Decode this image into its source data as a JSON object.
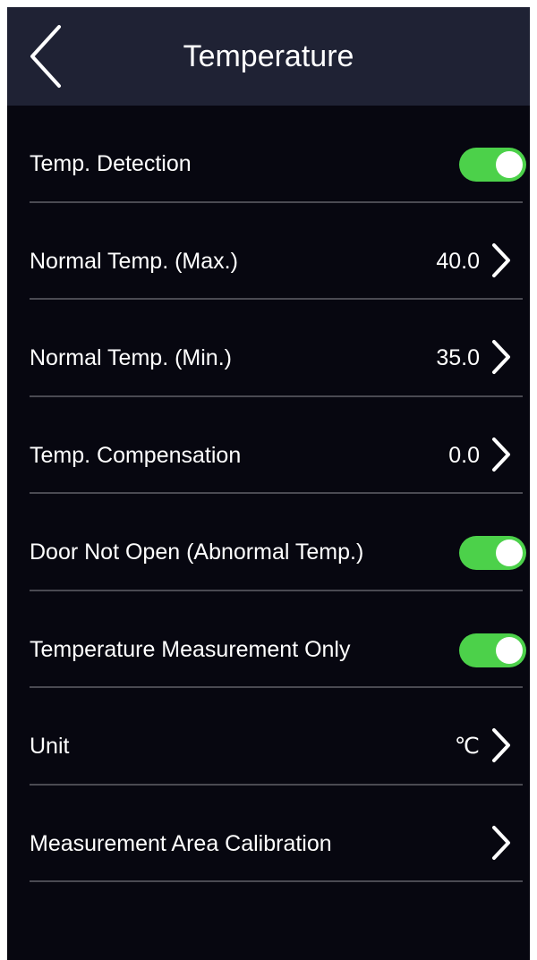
{
  "header": {
    "title": "Temperature",
    "back_icon": "chevron-left-icon"
  },
  "colors": {
    "background": "#070710",
    "header_background": "#1f2234",
    "toggle_on": "#4cd14a",
    "divider": "#4a4a52",
    "text": "#ffffff"
  },
  "rows": [
    {
      "label": "Temp. Detection",
      "type": "toggle",
      "on": true
    },
    {
      "label": "Normal Temp. (Max.)",
      "type": "value",
      "value": "40.0",
      "icon": "chevron-right-icon"
    },
    {
      "label": "Normal Temp. (Min.)",
      "type": "value",
      "value": "35.0",
      "icon": "chevron-right-icon"
    },
    {
      "label": "Temp. Compensation",
      "type": "value",
      "value": "0.0",
      "icon": "chevron-right-icon"
    },
    {
      "label": "Door Not Open (Abnormal Temp.)",
      "type": "toggle",
      "on": true
    },
    {
      "label": "Temperature Measurement Only",
      "type": "toggle",
      "on": true
    },
    {
      "label": "Unit",
      "type": "value",
      "value": "℃",
      "icon": "chevron-right-icon"
    },
    {
      "label": "Measurement Area Calibration",
      "type": "link",
      "icon": "chevron-right-icon"
    }
  ]
}
